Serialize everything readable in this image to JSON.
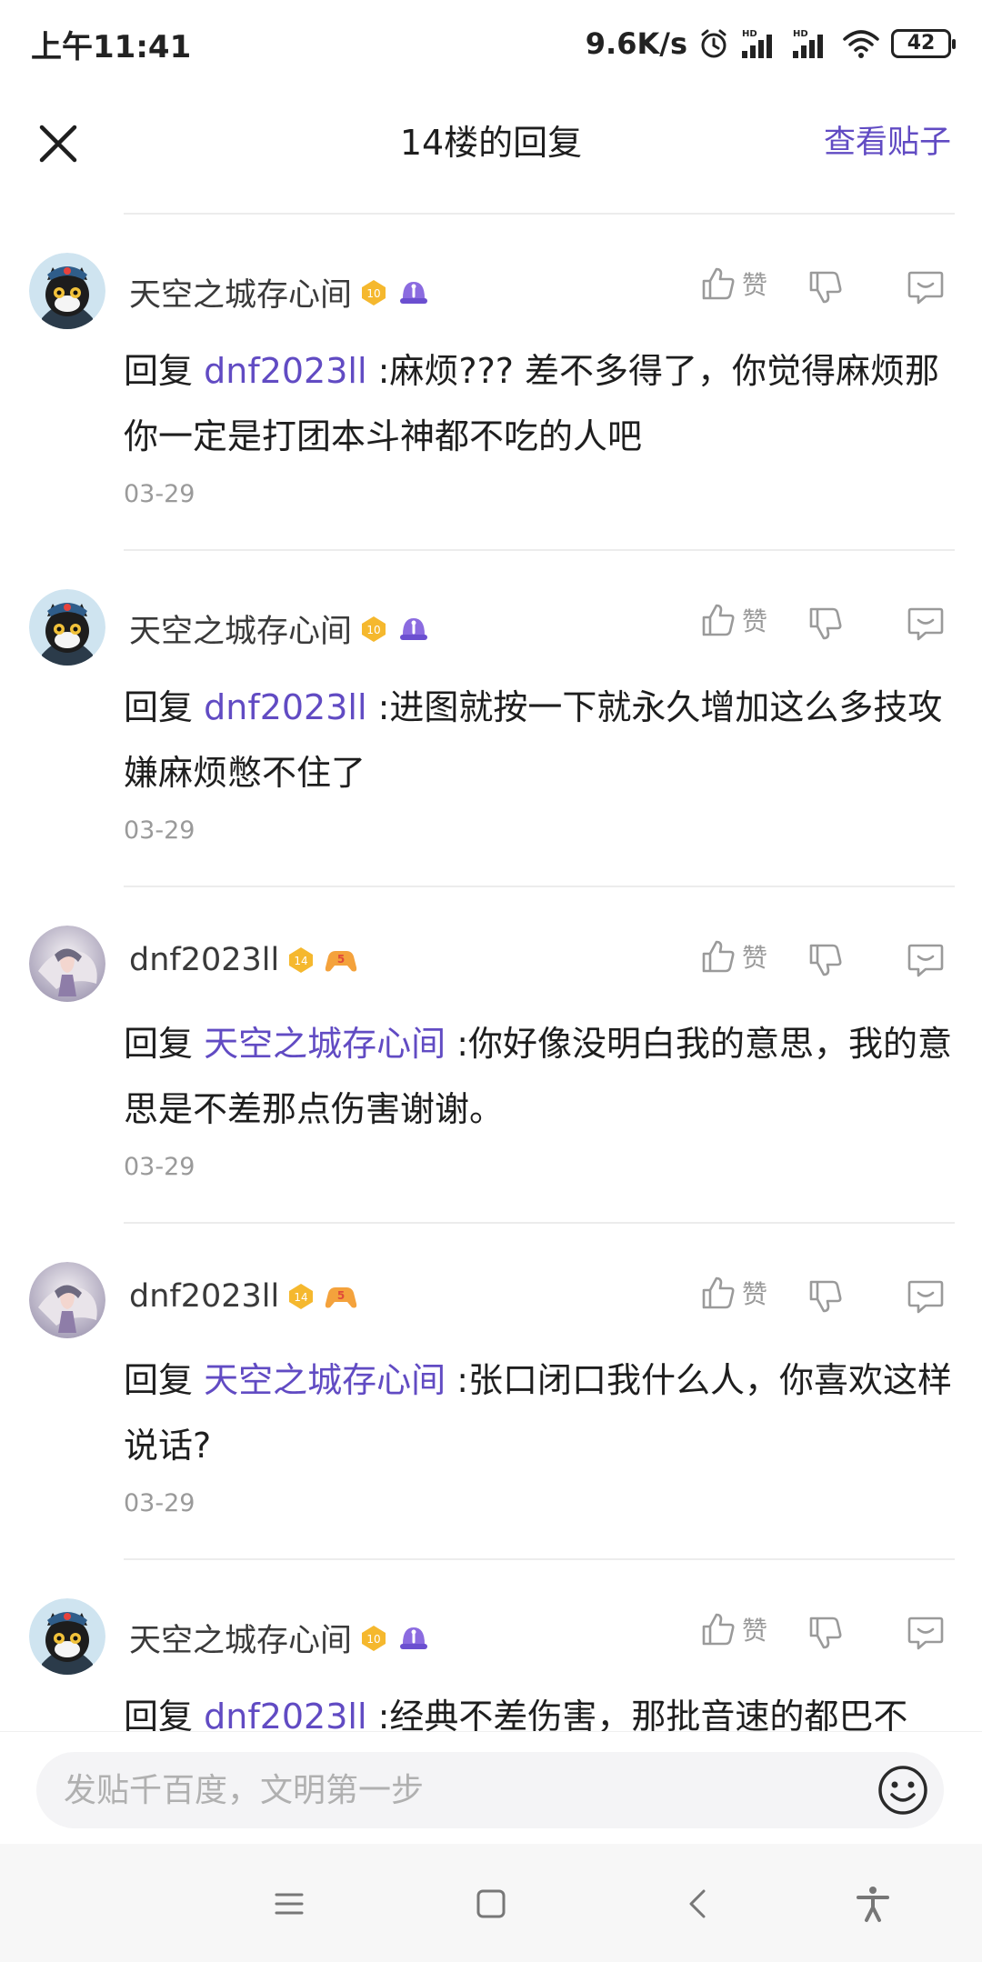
{
  "status": {
    "time": "上午11:41",
    "speed": "9.6K/s",
    "battery": "42"
  },
  "header": {
    "title": "14楼的回复",
    "view_post": "查看贴子"
  },
  "comments": [
    {
      "user": "天空之城存心间",
      "level": "10",
      "level_color": "#f5b82e",
      "like_label": "赞",
      "reply_prefix": "回复",
      "mention": "dnf2023ll",
      "text": " :麻烦??? 差不多得了，你觉得麻烦那你一定是打团本斗神都不吃的人吧",
      "date": "03-29"
    },
    {
      "user": "天空之城存心间",
      "level": "10",
      "level_color": "#f5b82e",
      "like_label": "赞",
      "reply_prefix": "回复",
      "mention": "dnf2023ll",
      "text": " :进图就按一下就永久增加这么多技攻嫌麻烦憋不住了",
      "date": "03-29"
    },
    {
      "user": "dnf2023ll",
      "level": "14",
      "level_color": "#f5b82e",
      "like_label": "赞",
      "reply_prefix": "回复",
      "mention": "天空之城存心间",
      "text": " :你好像没明白我的意思，我的意思是不差那点伤害谢谢。",
      "date": "03-29"
    },
    {
      "user": "dnf2023ll",
      "level": "14",
      "level_color": "#f5b82e",
      "like_label": "赞",
      "reply_prefix": "回复",
      "mention": "天空之城存心间",
      "text": " :张口闭口我什么人，你喜欢这样说话?",
      "date": "03-29"
    },
    {
      "user": "天空之城存心间",
      "level": "10",
      "level_color": "#f5b82e",
      "like_label": "赞",
      "reply_prefix": "回复",
      "mention": "dnf2023ll",
      "text": " :经典不差伤害，那批音速的都巴不",
      "date": ""
    }
  ],
  "input": {
    "placeholder": "发贴千百度，文明第一步"
  },
  "colors": {
    "accent": "#614bc3",
    "muted": "#9a9a9a"
  }
}
